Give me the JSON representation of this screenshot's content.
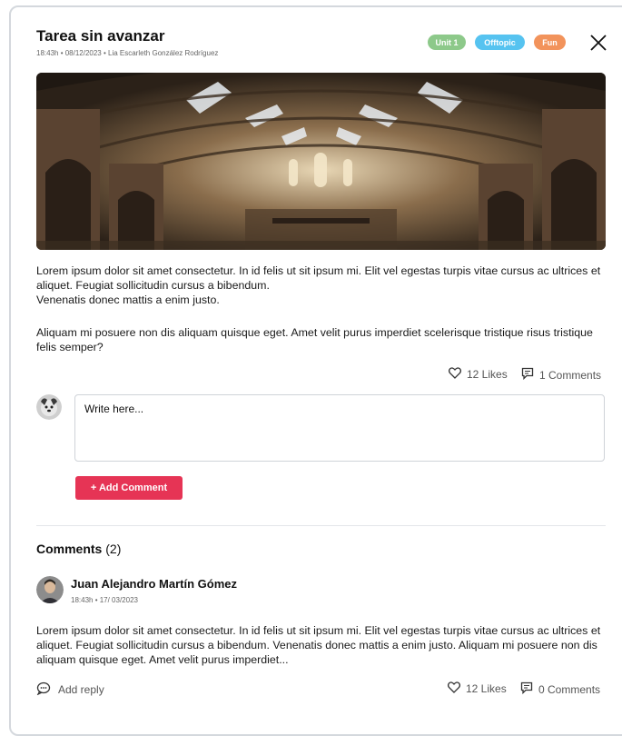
{
  "post": {
    "title": "Tarea sin avanzar",
    "meta": "18:43h • 08/12/2023 • Lia Escarleth González Rodríguez",
    "badges": [
      {
        "label": "Unit 1",
        "color": "#8dc98a"
      },
      {
        "label": "Offtopic",
        "color": "#56c3f0"
      },
      {
        "label": "Fun",
        "color": "#f2935b"
      }
    ],
    "paragraph1": "Lorem ipsum dolor sit amet consectetur. In id felis ut sit ipsum mi. Elit vel egestas turpis vitae cursus ac ultrices et aliquet. Feugiat sollicitudin cursus a bibendum.",
    "paragraph1b": "Venenatis donec mattis a enim justo.",
    "paragraph2": "Aliquam mi posuere non dis aliquam quisque eget. Amet velit purus imperdiet scelerisque tristique risus tristique felis semper?",
    "likes": "12 Likes",
    "comments_count": "1 Comments"
  },
  "composer": {
    "placeholder": "Write here...",
    "add_label": "+ Add Comment"
  },
  "comments_section": {
    "title": "Comments",
    "count": "(2)"
  },
  "comment": {
    "author": "Juan Alejandro Martín Gómez",
    "meta": "18:43h • 17/ 03/2023",
    "text": "Lorem ipsum dolor sit amet consectetur. In id felis ut sit ipsum mi. Elit vel egestas turpis vitae cursus ac ultrices et aliquet. Feugiat sollicitudin cursus a bibendum. Venenatis donec mattis a enim justo. Aliquam mi posuere non dis aliquam quisque eget. Amet velit purus imperdiet...",
    "reply_label": "Add reply",
    "likes": "12 Likes",
    "comments_count": "0 Comments"
  },
  "icons": {
    "close": "close-icon",
    "heart": "heart-icon",
    "comment": "comment-icon",
    "reply": "reply-bubble-icon"
  },
  "colors": {
    "accent": "#e63455"
  }
}
